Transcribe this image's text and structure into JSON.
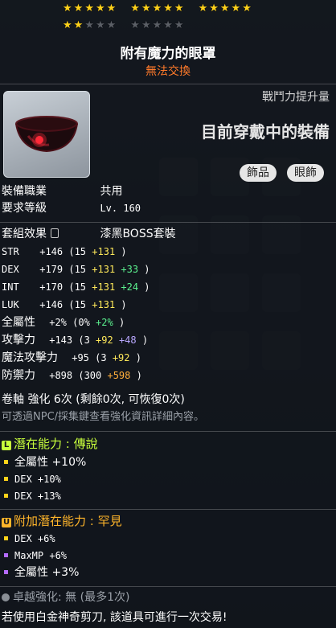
{
  "colors": {
    "star_filled": "#ffd21a",
    "star_empty": "#5b5f66",
    "untradeable": "#ff7a2a",
    "bonus_yellow": "#ffe95a",
    "bonus_green": "#5bf08e",
    "bonus_purple": "#b9a8ff",
    "bonus_orange": "#ffae3b",
    "legendary_potential": "#c8ff3c",
    "rare_potential": "#ffb52a"
  },
  "stars": {
    "filled": 17,
    "total": 25
  },
  "item": {
    "name": "附有魔力的眼罩",
    "trade_note": "無法交換"
  },
  "panel": {
    "power_label": "戰鬥力提升量",
    "equipped_label": "目前穿戴中的裝備",
    "tags": [
      "飾品",
      "眼飾"
    ]
  },
  "requirements": [
    {
      "label": "裝備職業",
      "value": "共用"
    },
    {
      "label": "要求等級",
      "value": "Lv. 160"
    }
  ],
  "set_effect": {
    "label": "套組效果",
    "value": "漆黑BOSS套裝"
  },
  "stats": [
    {
      "name": "STR",
      "total": "+146",
      "base": "(15",
      "bonus": [
        {
          "t": "+131",
          "c": "yellow"
        }
      ],
      "close": ")"
    },
    {
      "name": "DEX",
      "total": "+179",
      "base": "(15",
      "bonus": [
        {
          "t": "+131",
          "c": "yellow"
        },
        {
          "t": "+33",
          "c": "green"
        }
      ],
      "close": ")"
    },
    {
      "name": "INT",
      "total": "+170",
      "base": "(15",
      "bonus": [
        {
          "t": "+131",
          "c": "yellow"
        },
        {
          "t": "+24",
          "c": "green"
        }
      ],
      "close": ")"
    },
    {
      "name": "LUK",
      "total": "+146",
      "base": "(15",
      "bonus": [
        {
          "t": "+131",
          "c": "yellow"
        }
      ],
      "close": ")"
    },
    {
      "name": "全屬性",
      "total": "+2%",
      "base": "(0%",
      "bonus": [
        {
          "t": "+2%",
          "c": "green"
        }
      ],
      "close": ")"
    },
    {
      "name": "攻擊力",
      "total": "+143",
      "base": "(3",
      "bonus": [
        {
          "t": "+92",
          "c": "yellow"
        },
        {
          "t": "+48",
          "c": "purple"
        }
      ],
      "close": ")"
    },
    {
      "name": "魔法攻擊力",
      "total": "+95",
      "base": "(3",
      "bonus": [
        {
          "t": "+92",
          "c": "yellow"
        }
      ],
      "close": ")"
    },
    {
      "name": "防禦力",
      "total": "+898",
      "base": "(300",
      "bonus": [
        {
          "t": "+598",
          "c": "orange"
        }
      ],
      "close": ")"
    }
  ],
  "scroll": {
    "text": "卷軸 強化 6次 (剩餘0次, 可恢復0次)",
    "note": "可透過NPC/採集鍵查看強化資訊詳細內容。"
  },
  "potential": {
    "badge": "L",
    "title": "潛在能力 : 傳說",
    "lines": [
      "全屬性 +10%",
      "DEX +10%",
      "DEX +13%"
    ]
  },
  "bonus_potential": {
    "badge": "U",
    "title": "附加潛在能力 : 罕見",
    "lines": [
      "DEX +6%",
      "MaxMP +6%",
      "全屬性 +3%"
    ]
  },
  "exceptional": {
    "text": "卓越強化: 無 (最多1次)"
  },
  "footer": {
    "text": "若使用白金神奇剪刀, 該道具可進行一次交易!"
  }
}
